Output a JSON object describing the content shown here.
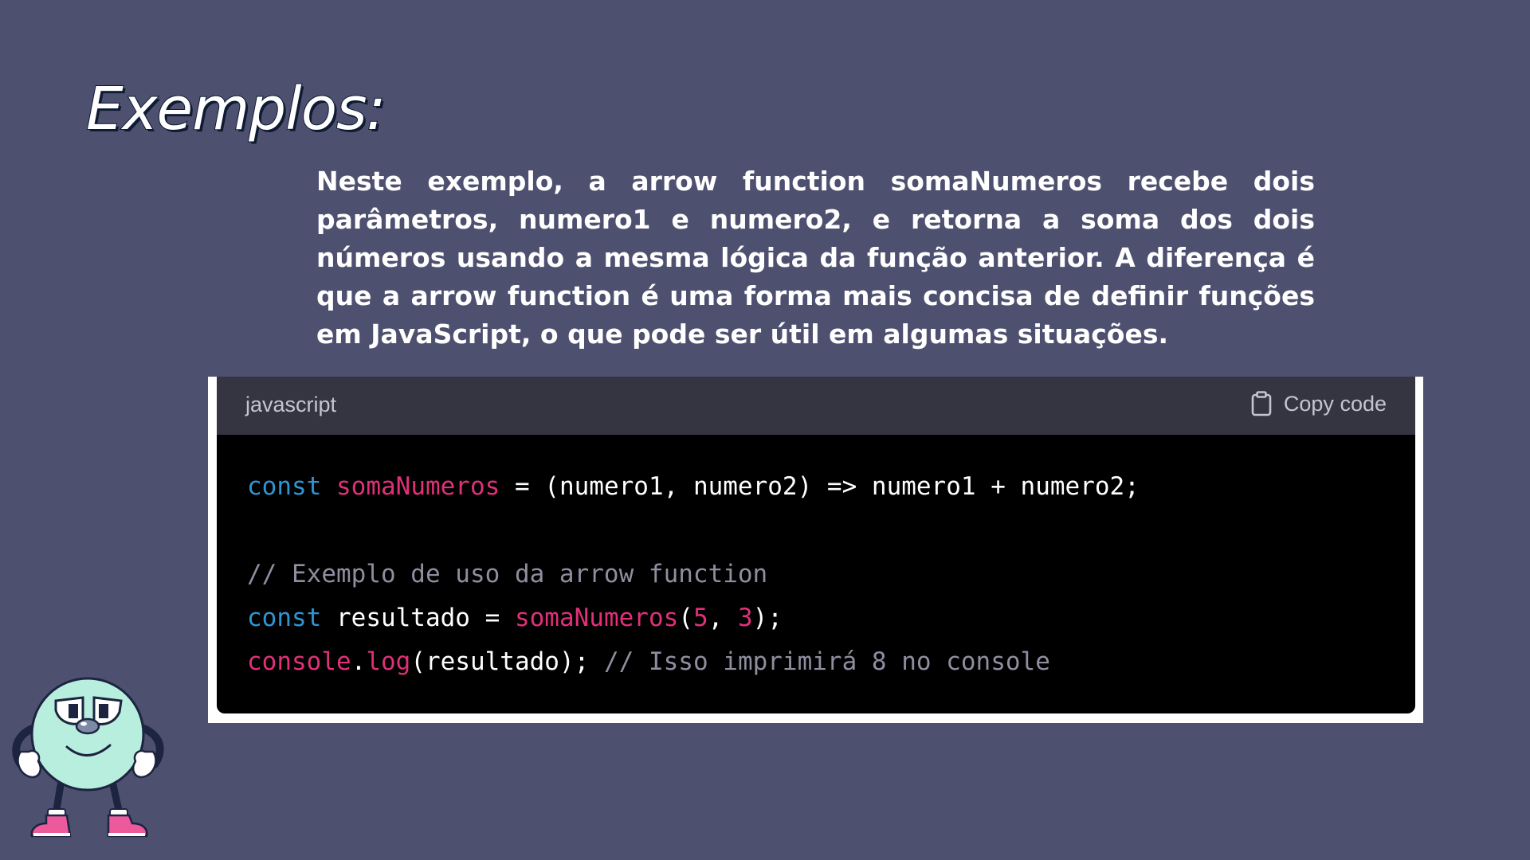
{
  "slide": {
    "title": "Exemplos:",
    "description": "Neste exemplo, a arrow function somaNumeros recebe dois parâmetros, numero1 e numero2, e retorna a soma dos dois números usando a mesma lógica da função anterior. A diferença é que a arrow function é uma forma mais concisa de definir funções em JavaScript, o que pode ser útil em algumas situações."
  },
  "code_block": {
    "language": "javascript",
    "copy_label": "Copy code",
    "copy_icon": "clipboard-icon",
    "lines": [
      [
        {
          "type": "kw",
          "text": "const"
        },
        {
          "type": "plain",
          "text": " "
        },
        {
          "type": "fn",
          "text": "somaNumeros"
        },
        {
          "type": "plain",
          "text": " = (numero1, numero2) => numero1 + numero2;"
        }
      ],
      [],
      [
        {
          "type": "cm",
          "text": "// Exemplo de uso da arrow function"
        }
      ],
      [
        {
          "type": "kw",
          "text": "const"
        },
        {
          "type": "plain",
          "text": " resultado = "
        },
        {
          "type": "fn",
          "text": "somaNumeros"
        },
        {
          "type": "plain",
          "text": "("
        },
        {
          "type": "num",
          "text": "5"
        },
        {
          "type": "plain",
          "text": ", "
        },
        {
          "type": "num",
          "text": "3"
        },
        {
          "type": "plain",
          "text": ");"
        }
      ],
      [
        {
          "type": "fn",
          "text": "console"
        },
        {
          "type": "plain",
          "text": "."
        },
        {
          "type": "fn",
          "text": "log"
        },
        {
          "type": "plain",
          "text": "(resultado); "
        },
        {
          "type": "cm",
          "text": "// Isso imprimirá 8 no console"
        }
      ]
    ]
  },
  "colors": {
    "background": "#4e5070",
    "code_keyword": "#2e95d3",
    "code_function": "#df3079",
    "code_comment": "#8e8ea0",
    "mascot_body": "#b8eedd",
    "mascot_shoes": "#ec5a9c"
  },
  "mascot": {
    "icon": "mascot-illustration"
  }
}
